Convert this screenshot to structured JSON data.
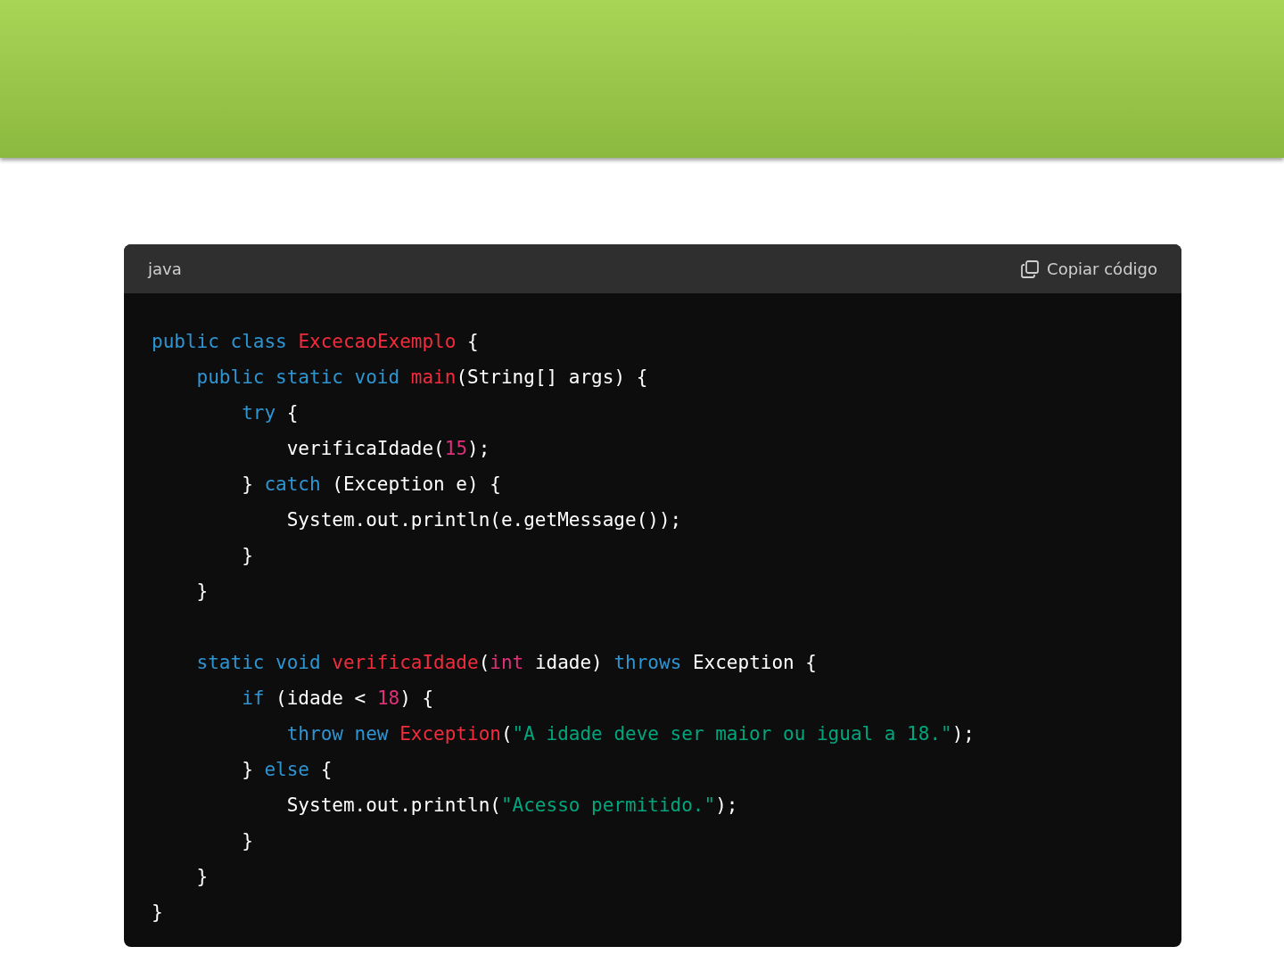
{
  "code_block": {
    "language": "java",
    "copy_button": "Copiar código",
    "lines": [
      {
        "tokens": [
          {
            "kind": "kw",
            "text": "public class "
          },
          {
            "kind": "name",
            "text": "ExcecaoExemplo"
          },
          {
            "kind": "plain",
            "text": " {"
          }
        ]
      },
      {
        "tokens": [
          {
            "kind": "kw",
            "text": "    public static void "
          },
          {
            "kind": "name",
            "text": "main"
          },
          {
            "kind": "plain",
            "text": "(String[] args) {"
          }
        ]
      },
      {
        "tokens": [
          {
            "kind": "kw",
            "text": "        try"
          },
          {
            "kind": "plain",
            "text": " {"
          }
        ]
      },
      {
        "tokens": [
          {
            "kind": "plain",
            "text": "            verificaIdade("
          },
          {
            "kind": "num",
            "text": "15"
          },
          {
            "kind": "plain",
            "text": ");"
          }
        ]
      },
      {
        "tokens": [
          {
            "kind": "plain",
            "text": "        } "
          },
          {
            "kind": "kw",
            "text": "catch"
          },
          {
            "kind": "plain",
            "text": " (Exception e) {"
          }
        ]
      },
      {
        "tokens": [
          {
            "kind": "plain",
            "text": "            System.out.println(e.getMessage());"
          }
        ]
      },
      {
        "tokens": [
          {
            "kind": "plain",
            "text": "        }"
          }
        ]
      },
      {
        "tokens": [
          {
            "kind": "plain",
            "text": "    }"
          }
        ]
      },
      {
        "kind": "blank"
      },
      {
        "tokens": [
          {
            "kind": "kw",
            "text": "    static void "
          },
          {
            "kind": "name",
            "text": "verificaIdade"
          },
          {
            "kind": "plain",
            "text": "("
          },
          {
            "kind": "num",
            "text": "int"
          },
          {
            "kind": "plain",
            "text": " idade) "
          },
          {
            "kind": "kw",
            "text": "throws"
          },
          {
            "kind": "plain",
            "text": " Exception {"
          }
        ]
      },
      {
        "tokens": [
          {
            "kind": "kw",
            "text": "        if"
          },
          {
            "kind": "plain",
            "text": " (idade < "
          },
          {
            "kind": "num",
            "text": "18"
          },
          {
            "kind": "plain",
            "text": ") {"
          }
        ]
      },
      {
        "tokens": [
          {
            "kind": "kw",
            "text": "            throw new "
          },
          {
            "kind": "name",
            "text": "Exception"
          },
          {
            "kind": "plain",
            "text": "("
          },
          {
            "kind": "str",
            "text": "\"A idade deve ser maior ou igual a 18.\""
          },
          {
            "kind": "plain",
            "text": ");"
          }
        ]
      },
      {
        "tokens": [
          {
            "kind": "plain",
            "text": "        } "
          },
          {
            "kind": "kw",
            "text": "else"
          },
          {
            "kind": "plain",
            "text": " {"
          }
        ]
      },
      {
        "tokens": [
          {
            "kind": "plain",
            "text": "            System.out.println("
          },
          {
            "kind": "str",
            "text": "\"Acesso permitido.\""
          },
          {
            "kind": "plain",
            "text": ");"
          }
        ]
      },
      {
        "tokens": [
          {
            "kind": "plain",
            "text": "        }"
          }
        ]
      },
      {
        "tokens": [
          {
            "kind": "plain",
            "text": "    }"
          }
        ]
      },
      {
        "tokens": [
          {
            "kind": "plain",
            "text": "}"
          }
        ]
      }
    ]
  }
}
